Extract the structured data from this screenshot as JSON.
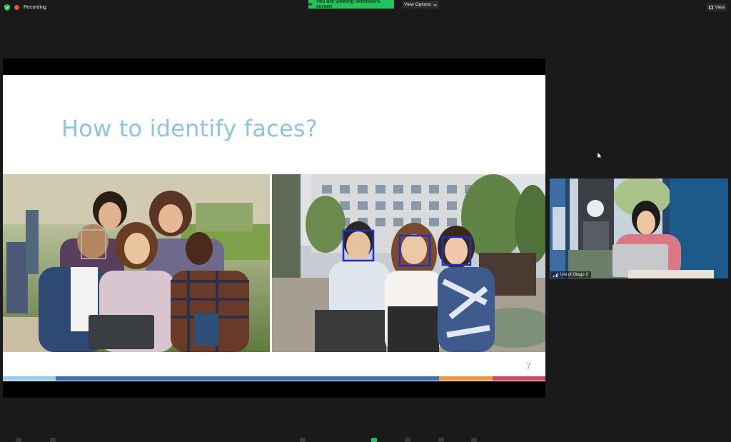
{
  "topbar": {
    "recording_label": "Recording",
    "viewing_banner": "You are viewing Veronika's screen",
    "view_options_label": "View Options",
    "view_label": "View"
  },
  "slide": {
    "title": "How to identify faces?",
    "number": "7",
    "accent_colors": [
      "#9bcbe9",
      "#3f6fb0",
      "#e69a3c",
      "#d9455a"
    ]
  },
  "participant": {
    "name": "Uni of Otago 3"
  },
  "colors": {
    "recording_green_banner": "#24c25a",
    "face_box": "#1f2ecf",
    "title_blue": "#8fc3e4"
  },
  "icons": [
    "shield-icon",
    "record-dot-icon",
    "speaker-icon",
    "chevron-down-icon",
    "grid-icon",
    "signal-bars-icon",
    "mouse-cursor-icon"
  ]
}
